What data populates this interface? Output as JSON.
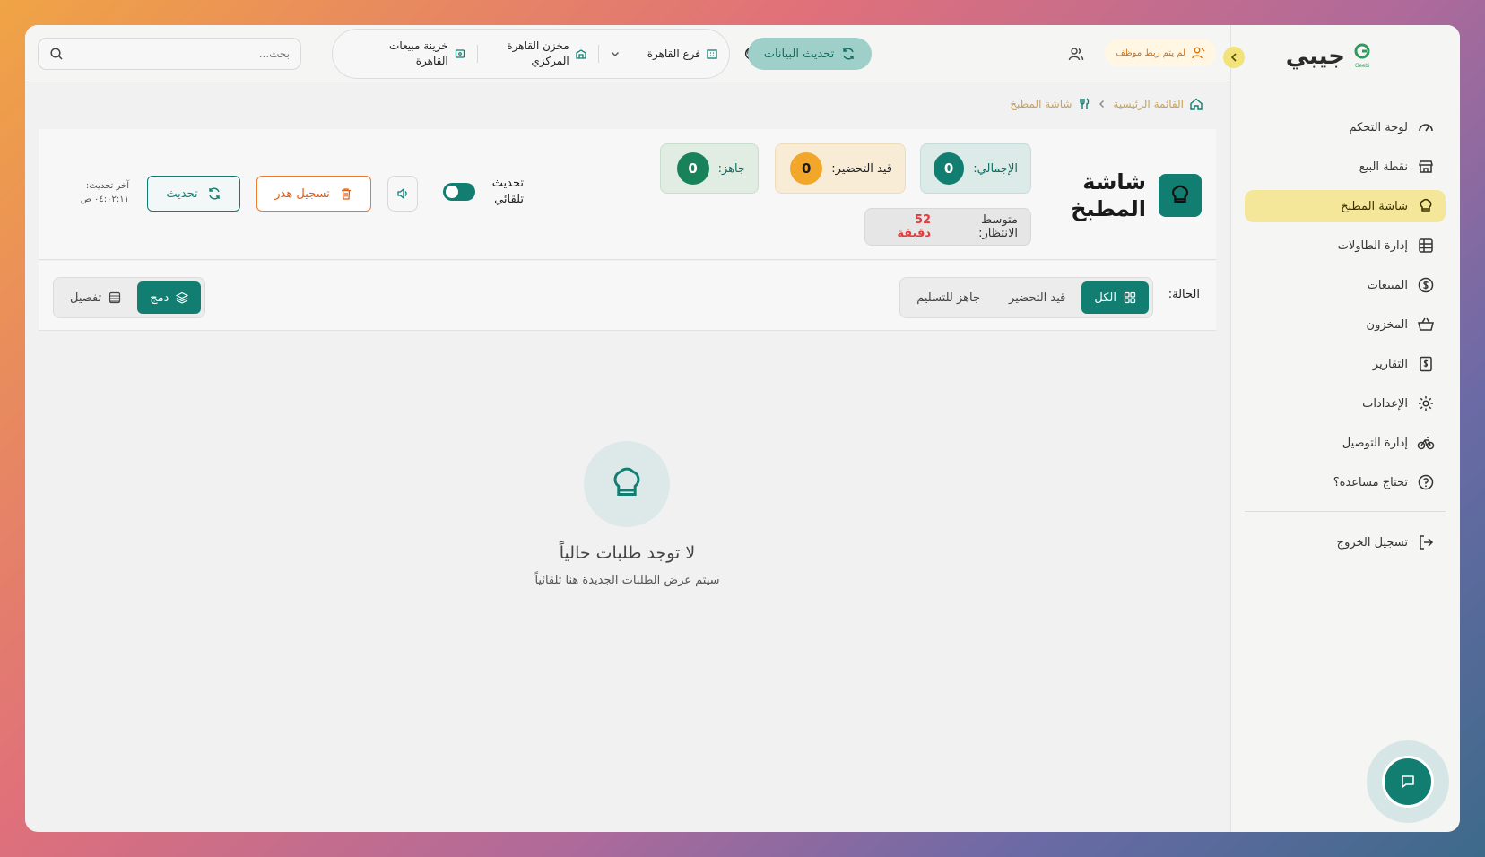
{
  "app": {
    "name": "جيبي",
    "logo_text": "Geebi"
  },
  "topbar": {
    "unlinked_badge": "لم يتم ربط موظف",
    "refresh_data": "تحديث البيانات",
    "branch": "فرع القاهرة",
    "warehouse": "مخزن القاهرة المركزي",
    "treasury": "خزينة مبيعات القاهرة",
    "search_placeholder": "بحث..."
  },
  "sidebar": {
    "items": [
      {
        "label": "لوحة التحكم",
        "icon": "gauge-icon"
      },
      {
        "label": "نقطة البيع",
        "icon": "store-icon"
      },
      {
        "label": "شاشة المطبخ",
        "icon": "chef-hat-icon",
        "active": true
      },
      {
        "label": "إدارة الطاولات",
        "icon": "table-icon"
      },
      {
        "label": "المبيعات",
        "icon": "dollar-circle-icon"
      },
      {
        "label": "المخزون",
        "icon": "basket-icon"
      },
      {
        "label": "التقارير",
        "icon": "receipt-icon"
      },
      {
        "label": "الإعدادات",
        "icon": "gear-icon"
      },
      {
        "label": "إدارة التوصيل",
        "icon": "bike-icon"
      },
      {
        "label": "تحتاج مساعدة؟",
        "icon": "help-icon"
      }
    ],
    "logout": "تسجيل الخروج"
  },
  "breadcrumb": {
    "home": "القائمة الرئيسية",
    "current": "شاشة المطبخ"
  },
  "header": {
    "title": "شاشة المطبخ",
    "total_label": "الإجمالي:",
    "total_value": "0",
    "prep_label": "قيد التحضير:",
    "prep_value": "0",
    "ready_label": "جاهز:",
    "ready_value": "0",
    "wait_label": "متوسط الانتظار:",
    "wait_value": "52 دقيقة",
    "auto_refresh_label": "تحديث تلقائي",
    "waste_button": "تسجيل هدر",
    "refresh_button": "تحديث",
    "last_update_label": "آخر تحديث:",
    "last_update_value": "٠٤:٠٢:١١ ص"
  },
  "filters": {
    "status_label": "الحالة:",
    "all": "الكل",
    "preparing": "قيد التحضير",
    "ready": "جاهز للتسليم",
    "merge": "دمج",
    "detail": "تفصيل"
  },
  "empty": {
    "title": "لا توجد طلبات حالياً",
    "subtitle": "سيتم عرض الطلبات الجديدة هنا تلقائياً"
  },
  "colors": {
    "accent": "#127e72",
    "active_nav": "#f4e79a",
    "danger": "#e23b3b"
  }
}
